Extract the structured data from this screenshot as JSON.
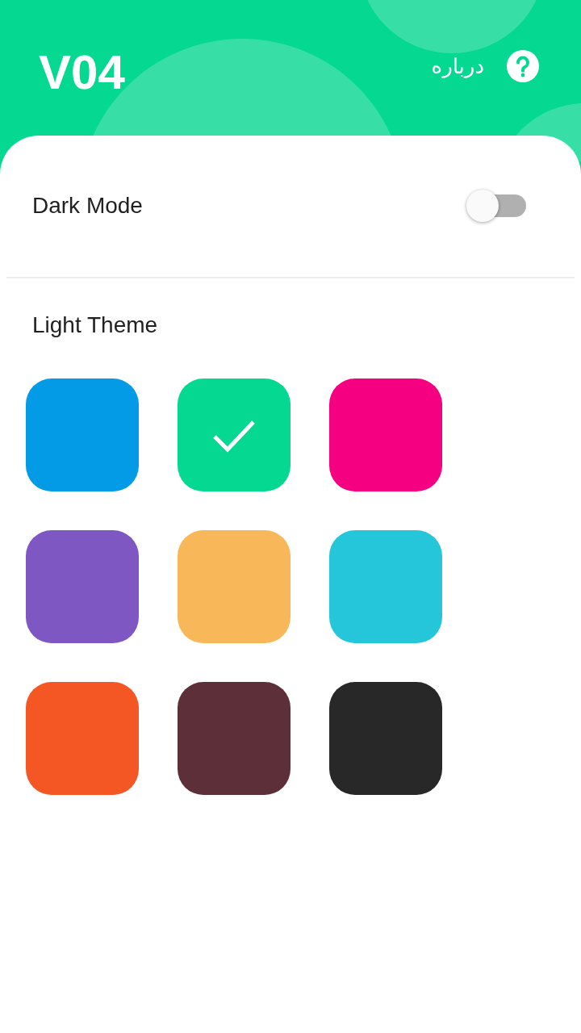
{
  "header": {
    "title": "V04",
    "about_label": "درباره"
  },
  "dark_mode": {
    "label": "Dark Mode",
    "on": false
  },
  "section_title": "Light Theme",
  "themes": [
    {
      "color": "#039be5",
      "selected": false
    },
    {
      "color": "#05d890",
      "selected": true
    },
    {
      "color": "#f50080",
      "selected": false
    },
    {
      "color": "#7e57c2",
      "selected": false
    },
    {
      "color": "#f8b85a",
      "selected": false
    },
    {
      "color": "#26c6da",
      "selected": false
    },
    {
      "color": "#f45724",
      "selected": false
    },
    {
      "color": "#5d2f39",
      "selected": false
    },
    {
      "color": "#282828",
      "selected": false
    }
  ]
}
